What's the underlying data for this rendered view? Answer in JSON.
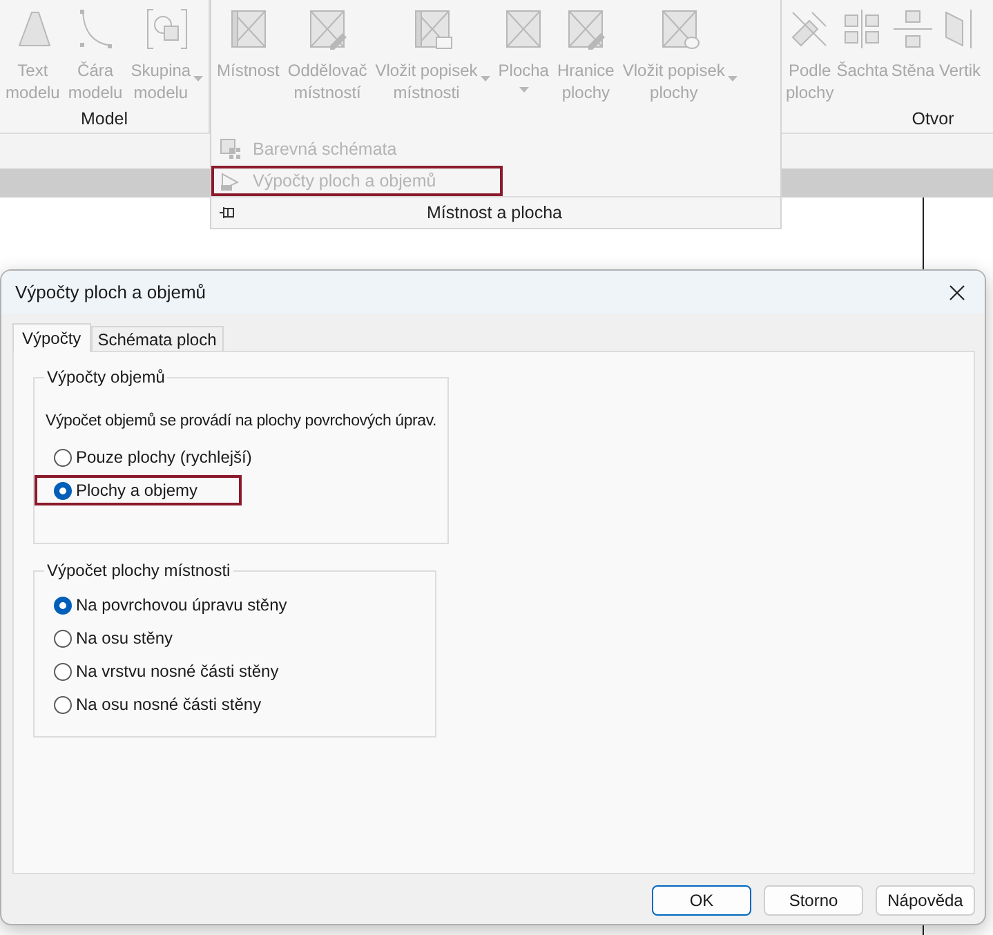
{
  "ribbon": {
    "panels": [
      {
        "label": "Model",
        "expanded": false,
        "buttons": [
          {
            "kind": "text",
            "label": "Text\nmodelu",
            "disabled": true
          },
          {
            "kind": "line",
            "label": "Čára\nmodelu",
            "disabled": true
          },
          {
            "kind": "group",
            "label": "Skupina\nmodelu",
            "disabled": true,
            "dropdown": true
          }
        ]
      },
      {
        "label": "Místnost a plocha",
        "expanded": true,
        "buttons": [
          {
            "kind": "room",
            "label": "Místnost",
            "disabled": true
          },
          {
            "kind": "room-separator",
            "label": "Oddělovač\nmístností",
            "disabled": true
          },
          {
            "kind": "room-tag",
            "label": "Vložit popisek\nmístnosti",
            "disabled": true,
            "dropdown": true
          },
          {
            "kind": "area",
            "label": "Plocha",
            "disabled": true,
            "dropdown": true
          },
          {
            "kind": "area-boundary",
            "label": "Hranice\nplochy",
            "disabled": true
          },
          {
            "kind": "area-tag",
            "label": "Vložit popisek\nplochy",
            "disabled": true,
            "dropdown": true
          }
        ],
        "menu": [
          {
            "kind": "color-schemes",
            "label": "Barevná schémata",
            "disabled": true,
            "highlighted": false
          },
          {
            "kind": "calculations",
            "label": "Výpočty ploch a objemů",
            "disabled": true,
            "highlighted": true
          }
        ]
      },
      {
        "label": "Otvor",
        "expanded": false,
        "buttons": [
          {
            "kind": "by-face",
            "label": "Podle\nplochy",
            "disabled": true
          },
          {
            "kind": "shaft",
            "label": "Šachta",
            "disabled": true
          },
          {
            "kind": "wall",
            "label": "Stěna",
            "disabled": true
          },
          {
            "kind": "vertical",
            "label": "Vertik",
            "disabled": true
          }
        ]
      }
    ]
  },
  "dialog": {
    "title": "Výpočty ploch a objemů",
    "tabs": [
      {
        "label": "Výpočty",
        "selected": true
      },
      {
        "label": "Schémata ploch",
        "selected": false
      }
    ],
    "groups": [
      {
        "title": "Výpočty objemů",
        "description": "Výpočet objemů se provádí na plochy povrchových úprav.",
        "options": [
          {
            "label": "Pouze plochy (rychlejší)",
            "selected": false,
            "highlighted": false
          },
          {
            "label": "Plochy a objemy",
            "selected": true,
            "highlighted": true
          }
        ]
      },
      {
        "title": "Výpočet plochy místnosti",
        "options": [
          {
            "label": "Na povrchovou úpravu stěny",
            "selected": true,
            "highlighted": false
          },
          {
            "label": "Na osu stěny",
            "selected": false,
            "highlighted": false
          },
          {
            "label": "Na vrstvu nosné části stěny",
            "selected": false,
            "highlighted": false
          },
          {
            "label": "Na osu nosné části stěny",
            "selected": false,
            "highlighted": false
          }
        ]
      }
    ],
    "buttons": [
      {
        "label": "OK",
        "default": true
      },
      {
        "label": "Storno",
        "default": false
      },
      {
        "label": "Nápověda",
        "default": false
      }
    ]
  }
}
